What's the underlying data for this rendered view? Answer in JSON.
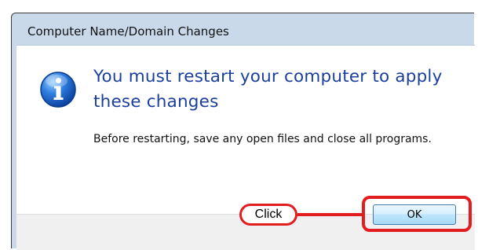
{
  "dialog": {
    "title": "Computer Name/Domain Changes",
    "icon": "info-icon",
    "main_message": "You must restart your computer to apply these changes",
    "detail_message": "Before restarting, save any open files and close all programs."
  },
  "buttons": {
    "ok_label": "OK"
  },
  "annotation": {
    "callout_label": "Click",
    "color": "#e11d20"
  }
}
